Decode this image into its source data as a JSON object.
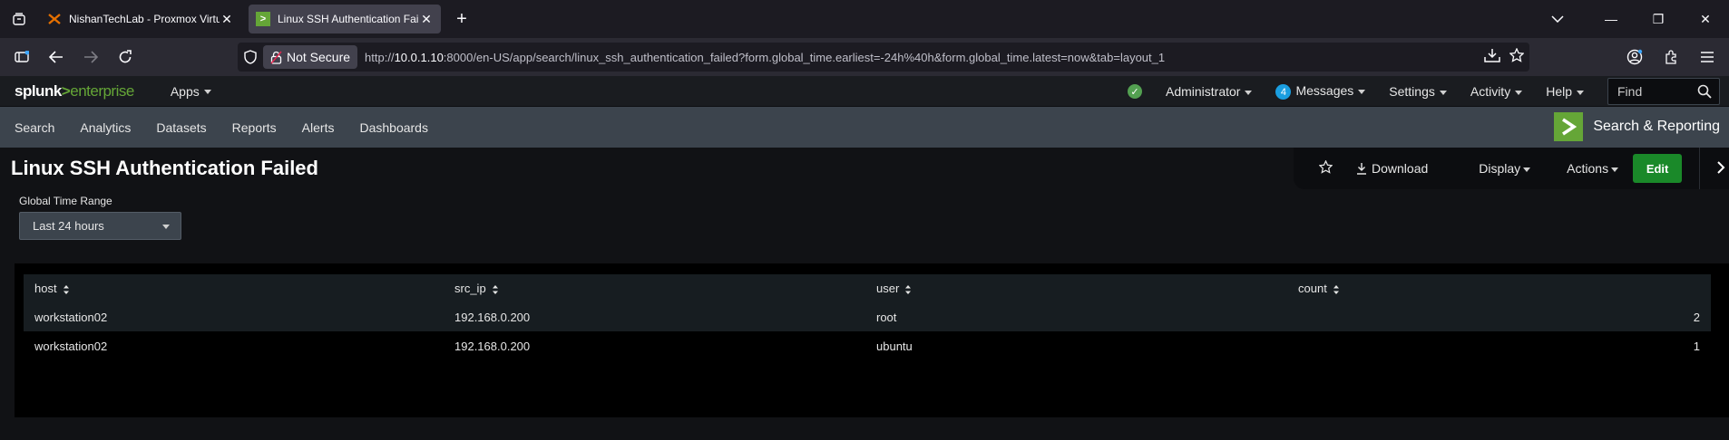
{
  "browser": {
    "tabs": [
      {
        "title": "NishanTechLab - Proxmox Virtual Environment",
        "active": false,
        "icon": "proxmox-icon"
      },
      {
        "title": "Linux SSH Authentication Failed",
        "active": true,
        "icon": "splunk-icon"
      }
    ],
    "security_label": "Not Secure",
    "url_prefix": "http://",
    "url_host": "10.0.1.10",
    "url_rest": ":8000/en-US/app/search/linux_ssh_authentication_failed?form.global_time.earliest=-24h%40h&form.global_time.latest=now&tab=layout_1"
  },
  "splunk": {
    "logo": {
      "part1": "splunk",
      "part2": ">",
      "part3": "enterprise"
    },
    "apps_label": "Apps",
    "user_label": "Administrator",
    "messages_count": "4",
    "messages_label": "Messages",
    "settings_label": "Settings",
    "activity_label": "Activity",
    "help_label": "Help",
    "find_placeholder": "Find",
    "nav": [
      "Search",
      "Analytics",
      "Datasets",
      "Reports",
      "Alerts",
      "Dashboards"
    ],
    "app_name": "Search & Reporting"
  },
  "dashboard": {
    "title": "Linux SSH Authentication Failed",
    "download_label": "Download",
    "display_label": "Display",
    "actions_label": "Actions",
    "edit_label": "Edit",
    "time_label": "Global Time Range",
    "time_value": "Last 24 hours"
  },
  "table": {
    "headers": [
      "host",
      "src_ip",
      "user",
      "count"
    ],
    "rows": [
      [
        "workstation02",
        "192.168.0.200",
        "root",
        "2"
      ],
      [
        "workstation02",
        "192.168.0.200",
        "ubuntu",
        "1"
      ]
    ]
  },
  "colors": {
    "accent_green": "#65a637",
    "edit_green": "#1a8929",
    "badge_blue": "#1a9ee0"
  }
}
